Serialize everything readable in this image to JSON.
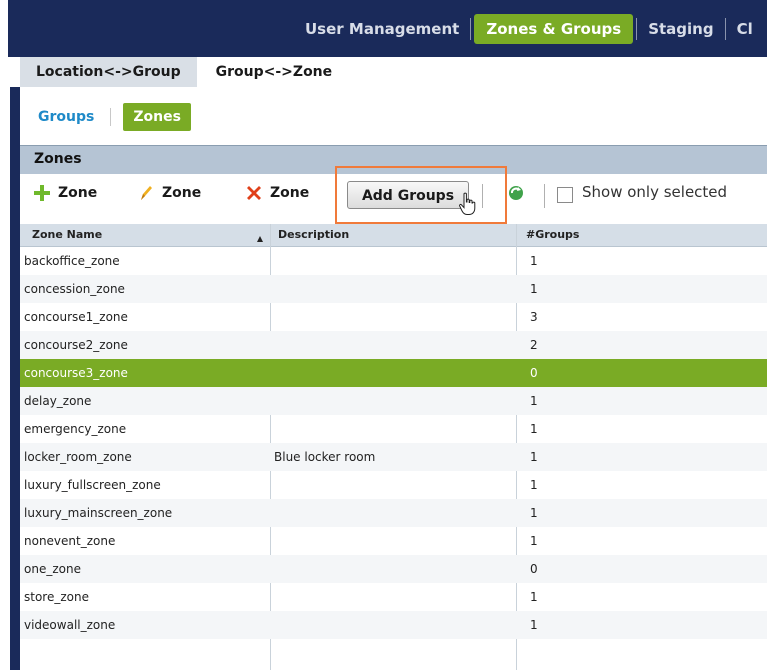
{
  "nav": {
    "items": [
      "User Management",
      "Zones & Groups",
      "Staging",
      "Cl"
    ],
    "active": "Zones & Groups"
  },
  "tabs": [
    "Location<->Group",
    "Group<->Zone"
  ],
  "subtabs": [
    "Groups",
    "Zones"
  ],
  "panel": {
    "title": "Zones"
  },
  "toolbar": {
    "add_zone": "Zone",
    "edit_zone": "Zone",
    "delete_zone": "Zone",
    "add_groups": "Add Groups",
    "show_only_selected": "Show only selected"
  },
  "table": {
    "columns": [
      "Zone Name",
      "Description",
      "#Groups"
    ],
    "rows": [
      {
        "name": "backoffice_zone",
        "description": "",
        "groups": "1"
      },
      {
        "name": "concession_zone",
        "description": "",
        "groups": "1"
      },
      {
        "name": "concourse1_zone",
        "description": "",
        "groups": "3"
      },
      {
        "name": "concourse2_zone",
        "description": "",
        "groups": "2"
      },
      {
        "name": "concourse3_zone",
        "description": "",
        "groups": "0"
      },
      {
        "name": "delay_zone",
        "description": "",
        "groups": "1"
      },
      {
        "name": "emergency_zone",
        "description": "",
        "groups": "1"
      },
      {
        "name": "locker_room_zone",
        "description": "Blue locker room",
        "groups": "1"
      },
      {
        "name": "luxury_fullscreen_zone",
        "description": "",
        "groups": "1"
      },
      {
        "name": "luxury_mainscreen_zone",
        "description": "",
        "groups": "1"
      },
      {
        "name": "nonevent_zone",
        "description": "",
        "groups": "1"
      },
      {
        "name": "one_zone",
        "description": "",
        "groups": "0"
      },
      {
        "name": "store_zone",
        "description": "",
        "groups": "1"
      },
      {
        "name": "videowall_zone",
        "description": "",
        "groups": "1"
      }
    ]
  },
  "colors": {
    "nav_bg": "#1a2a5a",
    "accent_green": "#7aab25",
    "highlight_orange": "#f07a3a"
  }
}
